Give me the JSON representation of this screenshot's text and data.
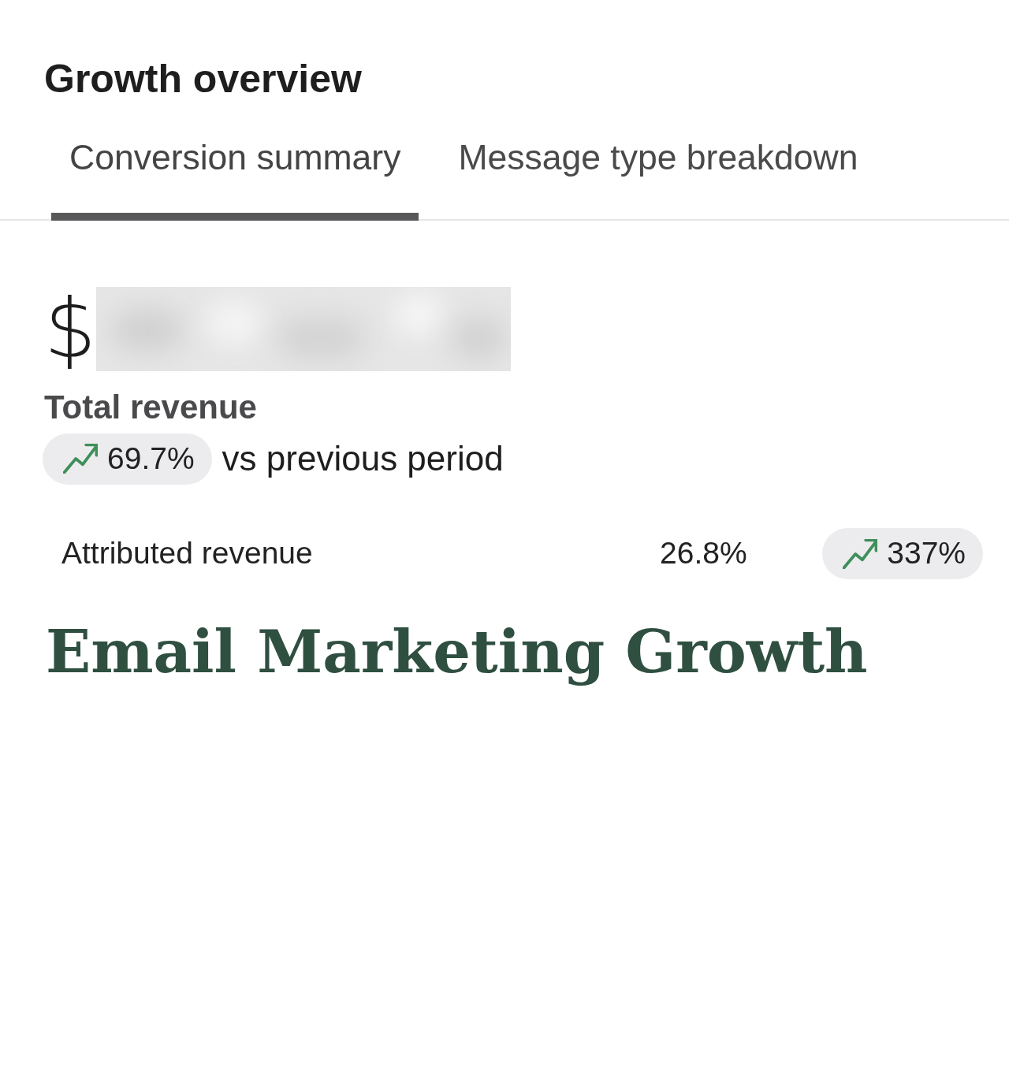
{
  "header": {
    "title": "Growth overview"
  },
  "tabs": [
    {
      "label": "Conversion summary",
      "selected": true
    },
    {
      "label": "Message type breakdown",
      "selected": false
    }
  ],
  "total": {
    "currency": "$",
    "value_redacted": true,
    "label": "Total revenue",
    "change": {
      "rising": true,
      "value": "69.7%"
    },
    "comparison": "vs previous period"
  },
  "metrics": [
    {
      "label": "Attributed revenue",
      "share": "26.8%",
      "change": {
        "rising": true,
        "value": "337%"
      }
    }
  ],
  "caption": "Email Marketing Growth"
}
